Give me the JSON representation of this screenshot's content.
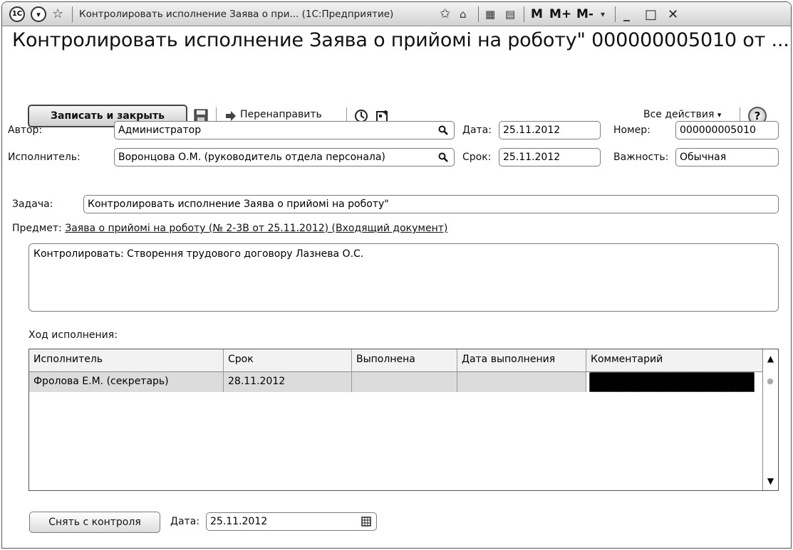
{
  "titlebar": {
    "logo_icon": "1c-logo-icon",
    "title": "Контролировать исполнение Заява о при... (1С:Предприятие)",
    "m_label": "M",
    "mplus_label": "M+",
    "mminus_label": "M-",
    "minimize": "_",
    "maximize": "□",
    "close": "✕"
  },
  "doc_title": "Контролировать исполнение Заява о прийомі на роботу\" 000000005010 от ...",
  "toolbar": {
    "save_close_label": "Записать и закрыть",
    "redirect_label": "Перенаправить",
    "all_actions_label": "Все действия",
    "help_label": "?"
  },
  "form": {
    "author_label": "Автор:",
    "author_value": "Администратор",
    "date_label": "Дата:",
    "date_value": "25.11.2012",
    "number_label": "Номер:",
    "number_value": "000000005010",
    "executor_label": "Исполнитель:",
    "executor_value": "Воронцова О.М. (руководитель отдела персонала)",
    "deadline_label": "Срок:",
    "deadline_value": "25.11.2012",
    "importance_label": "Важность:",
    "importance_value": "Обычная",
    "task_label": "Задача:",
    "task_value": "Контролировать исполнение Заява о прийомі на роботу\"",
    "subject_label": "Предмет:",
    "subject_link": "Заява о прийомі на роботу (№ 2-3В от 25.11.2012) (Входящий документ)",
    "description": "Контролировать: Створення трудового договору Лазнева О.С."
  },
  "progress": {
    "label": "Ход исполнения:",
    "columns": [
      "Исполнитель",
      "Срок",
      "Выполнена",
      "Дата выполнения",
      "Комментарий"
    ],
    "rows": [
      {
        "executor": "Фролова Е.М. (секретарь)",
        "deadline": "28.11.2012",
        "done": "",
        "done_date": "",
        "comment": ""
      }
    ]
  },
  "footer": {
    "remove_control_label": "Снять с контроля",
    "date_label": "Дата:",
    "date_value": "25.11.2012"
  }
}
